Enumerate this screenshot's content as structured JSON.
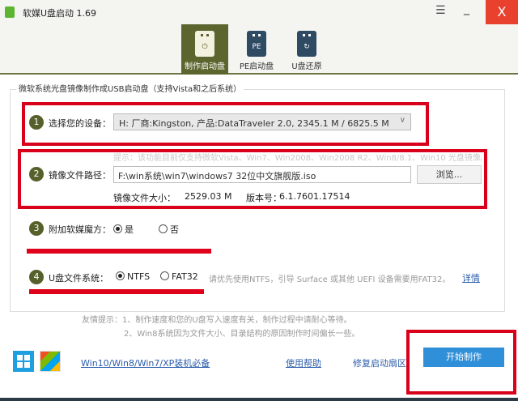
{
  "window": {
    "title": "软媒U盘启动 1.69",
    "menu_icon": "hamburger-icon",
    "minimize": "_",
    "close": "X"
  },
  "tabs": [
    {
      "label": "制作启动盘",
      "icon": "power",
      "active": true
    },
    {
      "label": "PE启动盘",
      "icon": "PE"
    },
    {
      "label": "U盘还原",
      "icon": "restore"
    }
  ],
  "group_title": "微软系统光盘镜像制作成USB启动盘（支持Vista和之后系统）",
  "step1": {
    "num": "1",
    "label": "选择您的设备：",
    "device": "H: 厂商:Kingston, 产品:DataTraveler 2.0,  2345.1 M / 6825.5 M"
  },
  "step2": {
    "num": "2",
    "hint": "提示：该功能目前仅支持微软Vista、Win7、Win2008、Win2008 R2、Win8/8.1、Win10 光盘镜像。",
    "label": "镜像文件路径：",
    "path": "F:\\win系统\\win7\\windows7 32位中文旗舰版.iso",
    "browse": "浏览...",
    "size_label": "镜像文件大小：",
    "size": "2529.03 M",
    "version_label": "版本号：",
    "version": "6.1.7601.17514"
  },
  "step3": {
    "num": "3",
    "label": "附加软媒魔方：",
    "yes": "是",
    "no": "否"
  },
  "step4": {
    "num": "4",
    "label": "U盘文件系统：",
    "ntfs": "NTFS",
    "fat32": "FAT32",
    "note": "请优先使用NTFS，引导 Surface 或其他 UEFI 设备需要用FAT32。",
    "details": "详情"
  },
  "tips": {
    "line1": "友情提示：1、制作速度和您的U盘写入速度有关，制作过程中请耐心等待。",
    "line2": "2、Win8系统因为文件大小、目录结构的原因制作时间偏长一些。"
  },
  "footer": {
    "win_link": "Win10/Win8/Win7/XP装机必备",
    "help": "使用帮助",
    "repair": "修复启动扇区",
    "start": "开始制作"
  },
  "colors": {
    "accent": "#5b652d",
    "close": "#e8412e",
    "start": "#2f8fd8",
    "highlight": "#d9001b"
  }
}
